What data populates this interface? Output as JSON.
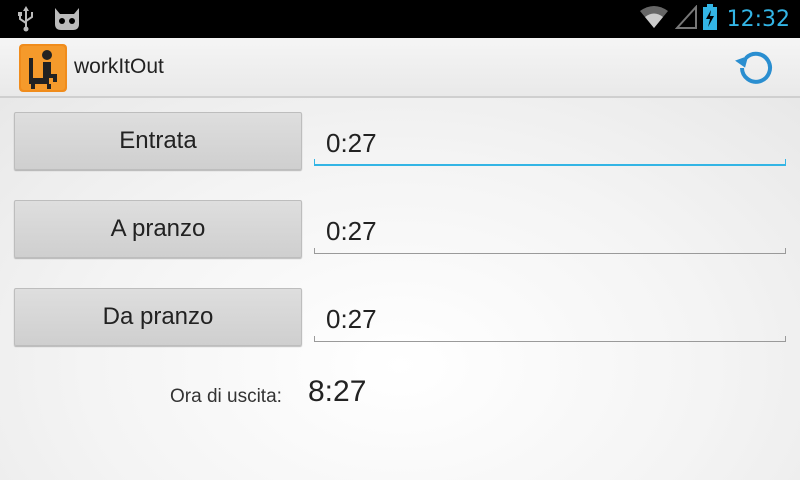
{
  "status_bar": {
    "time": "12:32",
    "icons": [
      "usb-icon",
      "cyanogenmod-icon",
      "wifi-icon",
      "signal-icon",
      "battery-charging-icon"
    ],
    "accent_color": "#33b5e5"
  },
  "action_bar": {
    "title": "workItOut",
    "app_icon": "app-launcher-icon",
    "refresh_icon": "refresh-icon"
  },
  "rows": [
    {
      "button_label": "Entrata",
      "time_value": "0:27",
      "focused": true
    },
    {
      "button_label": "A pranzo",
      "time_value": "0:27",
      "focused": false
    },
    {
      "button_label": "Da pranzo",
      "time_value": "0:27",
      "focused": false
    }
  ],
  "exit": {
    "label": "Ora di uscita:",
    "value": "8:27"
  }
}
